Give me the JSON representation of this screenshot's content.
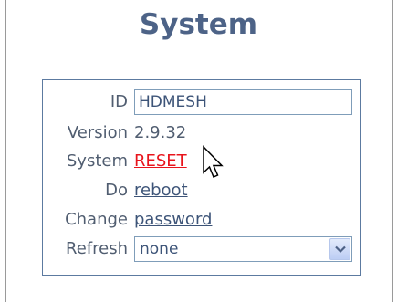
{
  "page": {
    "title": "System"
  },
  "form": {
    "id": {
      "label": "ID",
      "value": "HDMESH"
    },
    "version": {
      "label": "Version",
      "value": "2.9.32"
    },
    "system": {
      "label": "System",
      "link": "RESET"
    },
    "do": {
      "label": "Do",
      "link": "reboot"
    },
    "change": {
      "label": "Change",
      "link": "password"
    },
    "refresh": {
      "label": "Refresh",
      "selected": "none"
    }
  },
  "colors": {
    "title": "#4d6387",
    "text": "#505d70",
    "link": "#3d5478",
    "reset_link": "#e8141c",
    "box_border": "#5c7aa0"
  },
  "icons": {
    "dropdown": "chevron-down-icon",
    "cursor": "mouse-pointer-icon"
  }
}
